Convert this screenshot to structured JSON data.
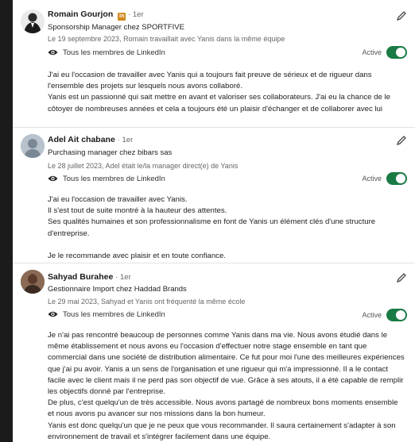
{
  "recommendations": [
    {
      "name": "Romain Gourjon",
      "degree": "· 1er",
      "badge": "in",
      "title": "Sponsorship Manager chez SPORTFIVE",
      "date": "Le 19 septembre 2023, Romain travaillait avec Yanis dans la même équipe",
      "visibility": "Tous les membres de LinkedIn",
      "status": "Active",
      "paragraphs": [
        "J'ai eu l'occasion de travailler avec Yanis qui a toujours fait preuve de sérieux et de rigueur dans l'ensemble des projets sur lesquels nous avons collaboré.",
        "Yanis est un passionné qui sait mettre en avant et valoriser ses collaborateurs. J'ai eu la chance de le côtoyer de nombreuses années et cela a toujours été un plaisir d'échanger et de collaborer avec lui"
      ]
    },
    {
      "name": "Adel Ait chabane",
      "degree": "· 1er",
      "title": "Purchasing manager chez bibars sas",
      "date": "Le 28 juillet 2023, Adel était le/la manager direct(e) de Yanis",
      "visibility": "Tous les membres de LinkedIn",
      "status": "Active",
      "paragraphs": [
        "J'ai eu l'occasion de travailler avec Yanis.",
        "Il s'est tout de suite montré à la hauteur des attentes.",
        "Ses qualités humaines et son professionnalisme en font de Yanis un élément clés d'une structure d'entreprise.",
        "Je le recommande avec plaisir et en toute confiance."
      ]
    },
    {
      "name": "Sahyad Burahee",
      "degree": "· 1er",
      "title": "Gestionnaire Import chez Haddad Brands",
      "date": "Le 29 mai 2023, Sahyad et Yanis ont fréquenté la même école",
      "visibility": "Tous les membres de LinkedIn",
      "status": "Active",
      "paragraphs": [
        "Je n'ai pas rencontré beaucoup de personnes comme Yanis dans ma vie. Nous avons étudié dans le même établissement et nous avons eu l'occasion d'effectuer notre stage ensemble en tant que commercial dans une société de distribution alimentaire. Ce fut pour moi l'une des meilleures expériences que j'ai pu avoir. Yanis a un sens de l'organisation et une rigueur qui m'a impressionné. Il a le contact facile avec le client mais il ne perd pas son objectif de vue. Grâce à ses atouts, il a été capable de remplir les objectifs donné par l'entreprise.",
        "De plus, c'est quelqu'un de très accessible. Nous avons partagé de nombreux bons moments ensemble et nous avons pu avancer sur nos missions dans la bon humeur.",
        "Yanis est donc quelqu'un que je ne peux que vous recommander. Il saura certainement s'adapter à son environnement de travail et s'intégrer facilement dans une équipe."
      ]
    }
  ],
  "colors": {
    "toggle": "#1a7a44",
    "badge": "#d08a1e"
  },
  "icons": {
    "edit": "pencil-icon",
    "visibility": "eye-icon"
  }
}
